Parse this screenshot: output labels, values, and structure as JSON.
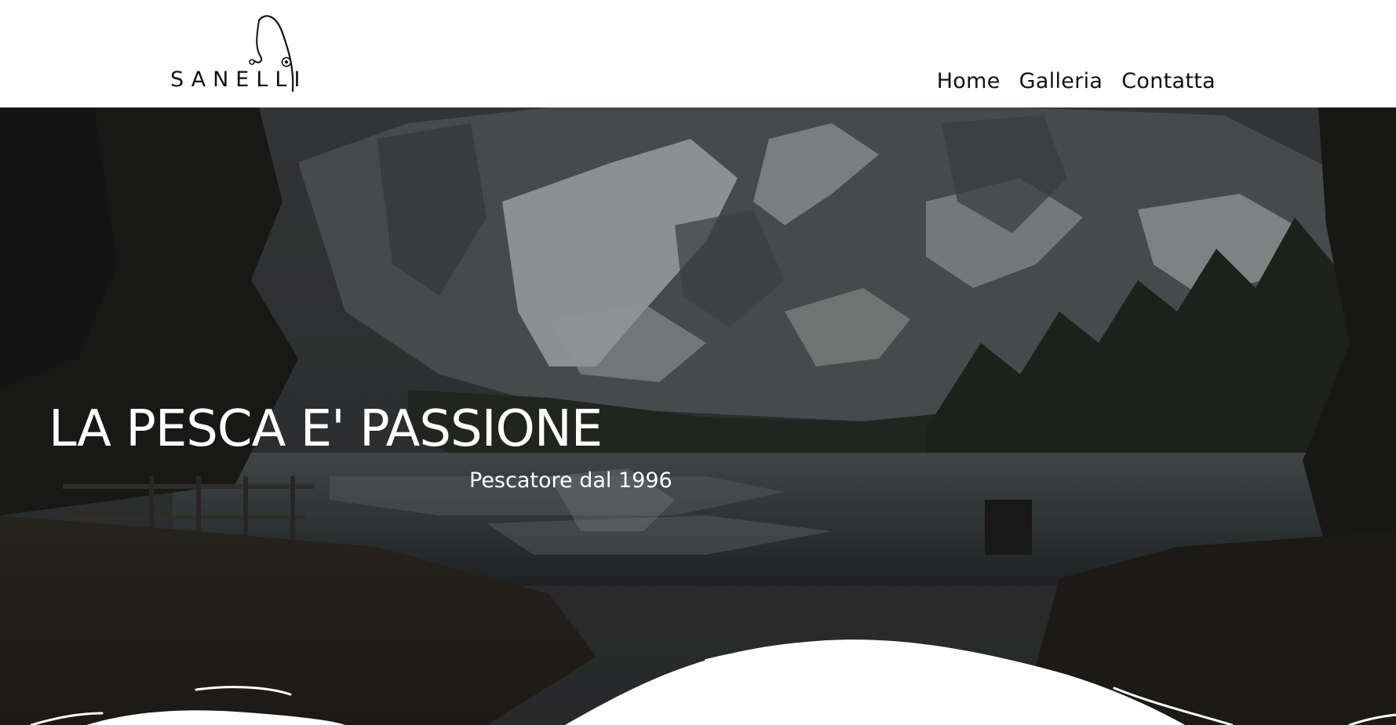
{
  "brand": {
    "logo_text": "SANELLI"
  },
  "nav": {
    "items": [
      {
        "label": "Home"
      },
      {
        "label": "Galleria"
      },
      {
        "label": "Contatta"
      }
    ]
  },
  "hero": {
    "title": "LA PESCA E' PASSIONE",
    "subtitle": "Pescatore dal 1996"
  },
  "colors": {
    "header_bg": "#ffffff",
    "text_dark": "#111111",
    "hero_text": "#ffffff",
    "hero_overlay": "#1f2021"
  },
  "icons": {
    "logo_mark": "fishing-hook-icon"
  }
}
